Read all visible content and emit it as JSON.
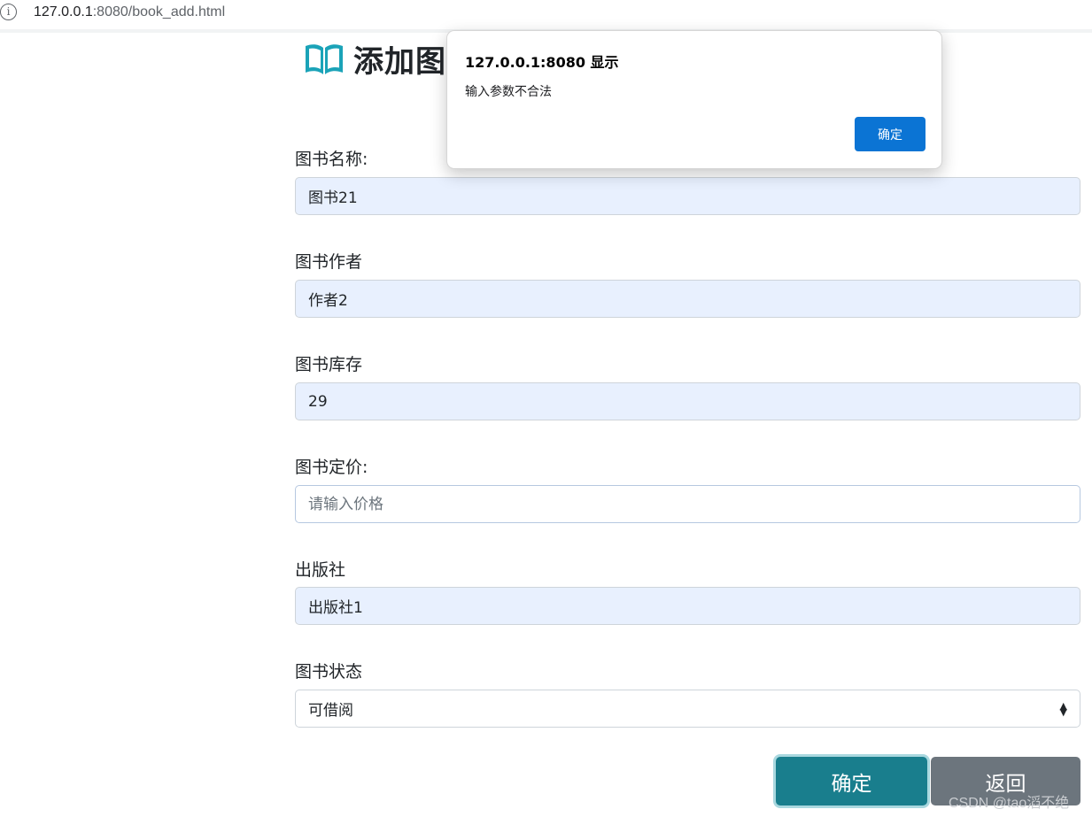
{
  "browser": {
    "url_host": "127.0.0.1",
    "url_rest": ":8080/book_add.html",
    "info_icon": "info-icon"
  },
  "page": {
    "title": "添加图",
    "title_icon": "book-icon",
    "accent_color": "#197e8d"
  },
  "form": {
    "name": {
      "label": "图书名称:",
      "value": "图书21"
    },
    "author": {
      "label": "图书作者",
      "value": "作者2"
    },
    "stock": {
      "label": "图书库存",
      "value": "29"
    },
    "price": {
      "label": "图书定价:",
      "value": "",
      "placeholder": "请输入价格"
    },
    "publisher": {
      "label": "出版社",
      "value": "出版社1"
    },
    "status": {
      "label": "图书状态",
      "selected": "可借阅"
    }
  },
  "buttons": {
    "confirm": "确定",
    "back": "返回"
  },
  "dialog": {
    "title": "127.0.0.1:8080 显示",
    "message": "输入参数不合法",
    "ok": "确定"
  },
  "watermark": "CSDN @tao滔不绝"
}
